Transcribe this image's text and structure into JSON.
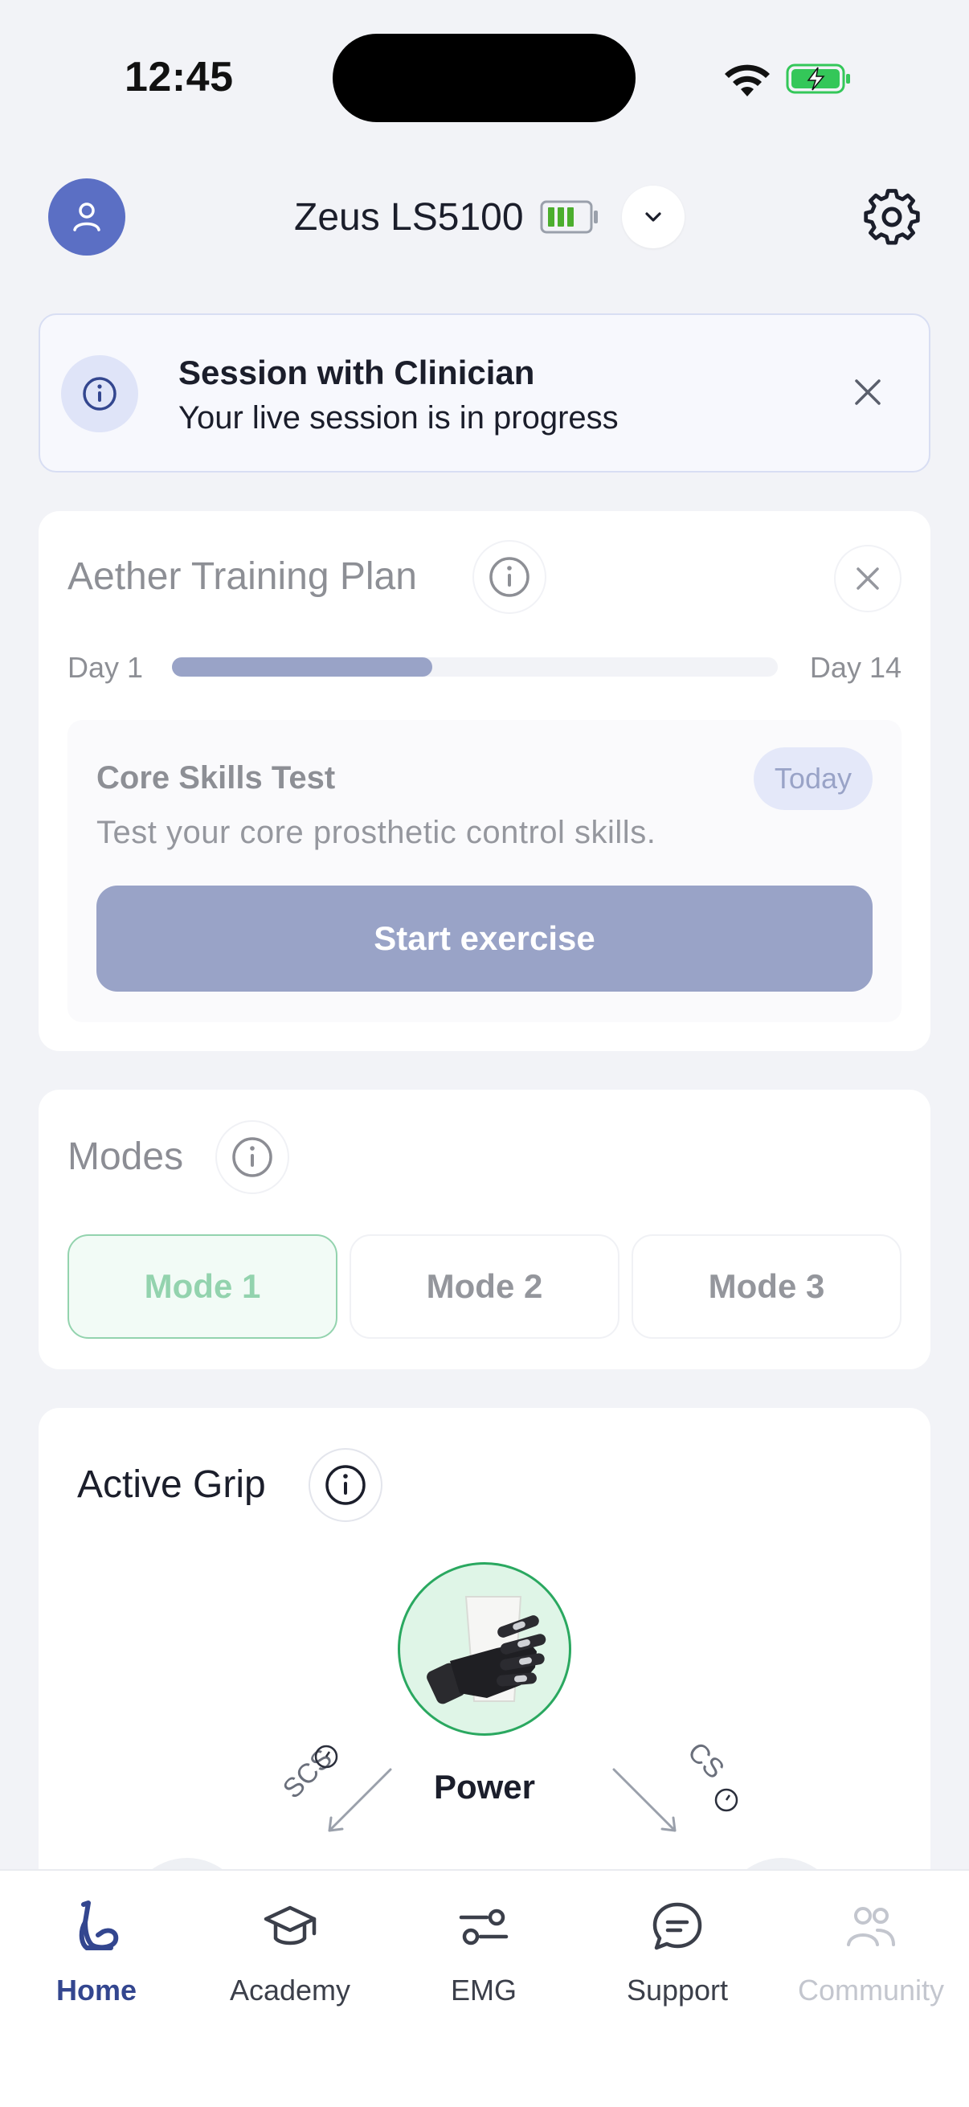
{
  "status_bar": {
    "time": "12:45",
    "icons": [
      "wifi-icon",
      "battery-charging-icon"
    ]
  },
  "header": {
    "device_name": "Zeus LS5100",
    "icons": [
      "user-icon",
      "device-battery-icon",
      "chevron-down-icon",
      "gear-icon"
    ]
  },
  "banner": {
    "title": "Session with Clinician",
    "subtitle": "Your live session is in progress",
    "icons": [
      "info-icon",
      "close-icon"
    ]
  },
  "training_plan": {
    "title": "Aether Training Plan",
    "start_label": "Day 1",
    "end_label": "Day 14",
    "progress_fraction": 0.43,
    "exercise": {
      "title": "Core Skills Test",
      "badge": "Today",
      "description": "Test your core prosthetic control skills.",
      "button": "Start exercise"
    }
  },
  "modes": {
    "title": "Modes",
    "items": [
      {
        "label": "Mode 1",
        "active": true
      },
      {
        "label": "Mode 2",
        "active": false
      },
      {
        "label": "Mode 3",
        "active": false
      }
    ]
  },
  "active_grip": {
    "title": "Active Grip",
    "grip_name": "Power",
    "left_label": "SCS",
    "right_label": "CS"
  },
  "tabs": [
    {
      "label": "Home",
      "icon": "arm-icon",
      "state": "active"
    },
    {
      "label": "Academy",
      "icon": "graduation-cap-icon",
      "state": "normal"
    },
    {
      "label": "EMG",
      "icon": "sliders-icon",
      "state": "normal"
    },
    {
      "label": "Support",
      "icon": "chat-icon",
      "state": "normal"
    },
    {
      "label": "Community",
      "icon": "people-icon",
      "state": "disabled"
    }
  ],
  "colors": {
    "accent": "#33468f",
    "active_green": "#2aa860",
    "avatar": "#5b6fc4"
  }
}
